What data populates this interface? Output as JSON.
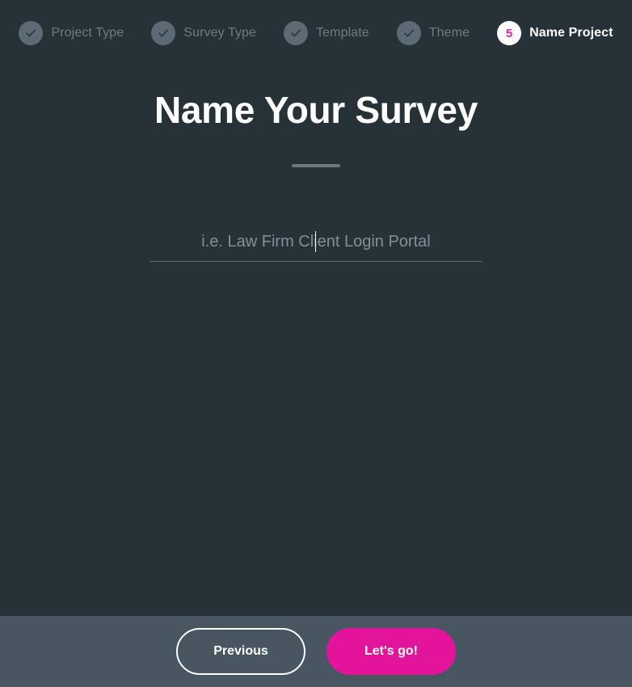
{
  "stepper": {
    "steps": [
      {
        "label": "Project Type",
        "state": "done",
        "number": "1",
        "icon": "check-icon"
      },
      {
        "label": "Survey Type",
        "state": "done",
        "number": "2",
        "icon": "check-icon"
      },
      {
        "label": "Template",
        "state": "done",
        "number": "3",
        "icon": "check-icon"
      },
      {
        "label": "Theme",
        "state": "done",
        "number": "4",
        "icon": "check-icon"
      },
      {
        "label": "Name Project",
        "state": "active",
        "number": "5",
        "icon": ""
      }
    ]
  },
  "main": {
    "title": "Name Your Survey",
    "name_input": {
      "value": "",
      "placeholder": "i.e. Law Firm Client Login Portal"
    }
  },
  "footer": {
    "previous_label": "Previous",
    "submit_label": "Let's go!"
  },
  "colors": {
    "background": "#263238",
    "footer_background": "#475660",
    "accent": "#e2149b",
    "step_done_circle": "#5b6a73",
    "step_label": "#6e7b85",
    "active_label": "#ffffff",
    "rule": "#6b7880",
    "input_underline": "#5d6a72",
    "placeholder": "#828f99"
  }
}
